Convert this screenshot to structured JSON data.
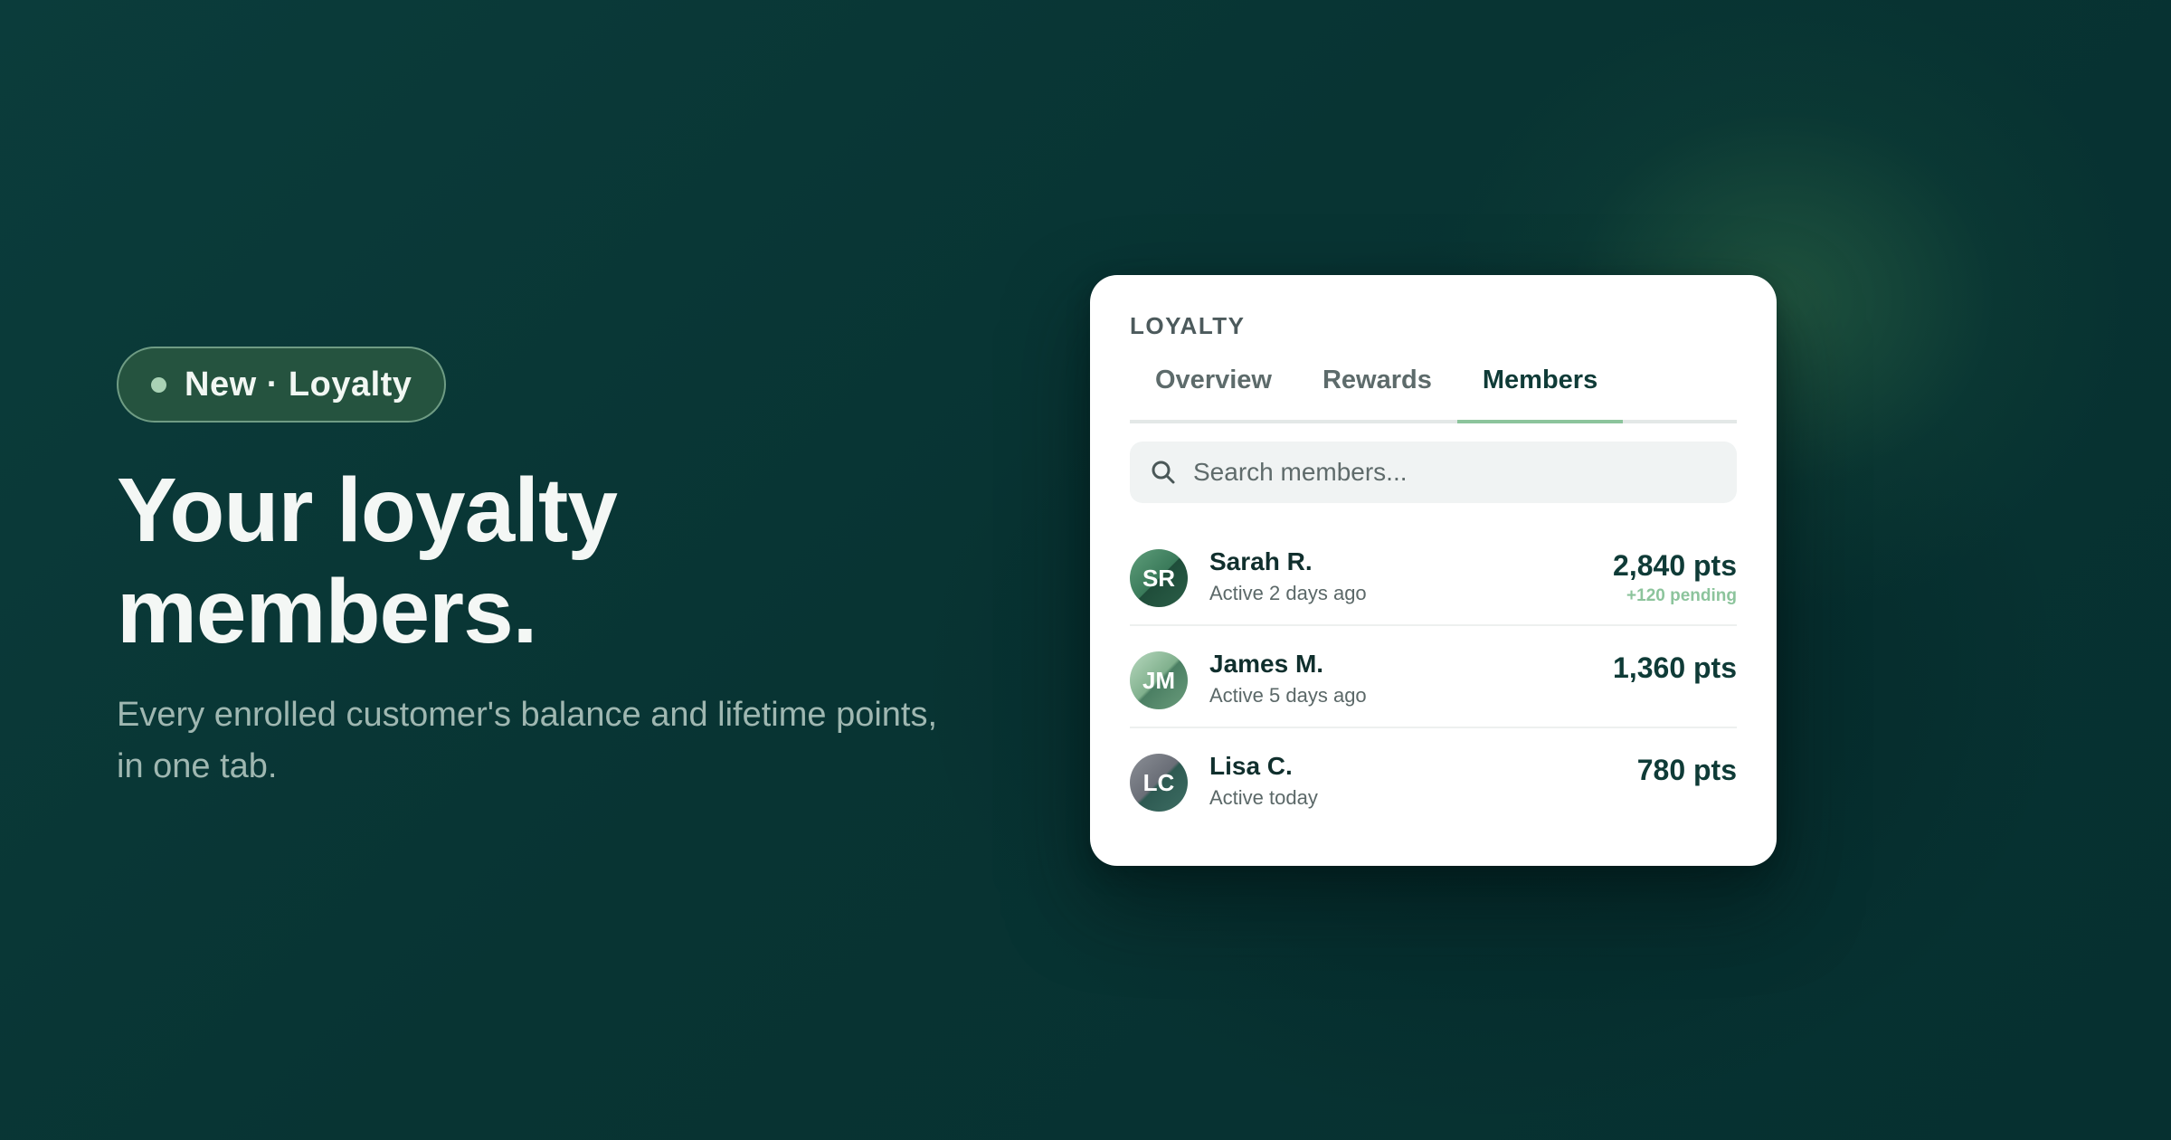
{
  "hero": {
    "badge": "New · Loyalty",
    "title_line1": "Your loyalty",
    "title_line2": "members.",
    "subtitle": "Every enrolled customer's balance and lifetime points, in one tab."
  },
  "card": {
    "eyebrow": "LOYALTY",
    "tabs": [
      {
        "label": "Overview",
        "active": false
      },
      {
        "label": "Rewards",
        "active": false
      },
      {
        "label": "Members",
        "active": true
      }
    ],
    "search": {
      "placeholder": "Search members...",
      "icon": "search-icon"
    },
    "members": [
      {
        "initials": "SR",
        "name": "Sarah R.",
        "status": "Active 2 days ago",
        "points": "2,840 pts",
        "pending": "+120 pending"
      },
      {
        "initials": "JM",
        "name": "James M.",
        "status": "Active 5 days ago",
        "points": "1,360 pts",
        "pending": null
      },
      {
        "initials": "LC",
        "name": "Lisa C.",
        "status": "Active today",
        "points": "780 pts",
        "pending": null
      }
    ]
  },
  "colors": {
    "background": "#083433",
    "accent": "#8cc49c",
    "badge_bg": "#25533f",
    "text_dark": "#0f3b37"
  }
}
